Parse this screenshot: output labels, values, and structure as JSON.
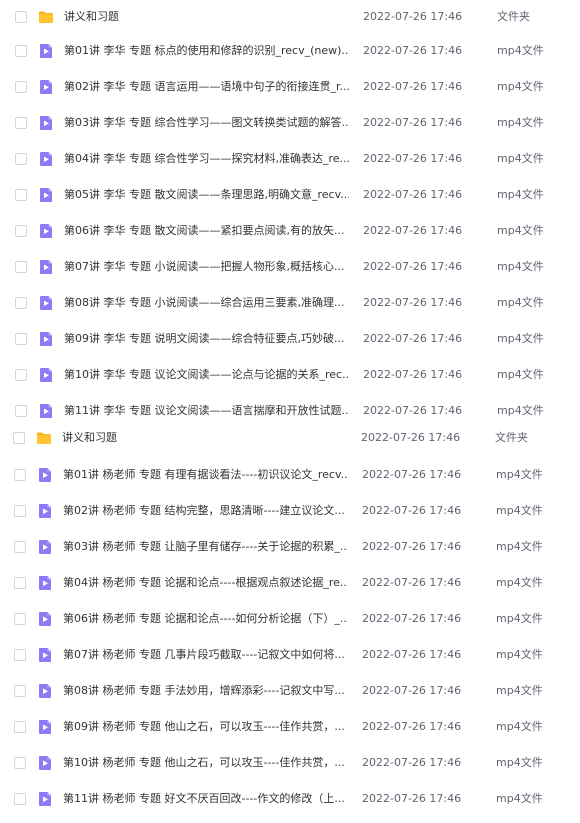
{
  "files": [
    {
      "name": "讲义和习题",
      "time": "2022-07-26 17:46",
      "type": "文件夹",
      "icon": "folder-icon"
    },
    {
      "name": "第01讲 李华 专题 标点的使用和修辞的识别_recv_(new)....",
      "time": "2022-07-26 17:46",
      "type": "mp4文件",
      "icon": "video-file-icon"
    },
    {
      "name": "第02讲 李华 专题 语言运用——语境中句子的衔接连贯_r...",
      "time": "2022-07-26 17:46",
      "type": "mp4文件",
      "icon": "video-file-icon"
    },
    {
      "name": "第03讲 李华 专题 综合性学习——图文转换类试题的解答...",
      "time": "2022-07-26 17:46",
      "type": "mp4文件",
      "icon": "video-file-icon"
    },
    {
      "name": "第04讲 李华 专题 综合性学习——探究材料,准确表达_re...",
      "time": "2022-07-26 17:46",
      "type": "mp4文件",
      "icon": "video-file-icon"
    },
    {
      "name": "第05讲 李华 专题 散文阅读——条理思路,明确文意_recv...",
      "time": "2022-07-26 17:46",
      "type": "mp4文件",
      "icon": "video-file-icon"
    },
    {
      "name": "第06讲 李华 专题 散文阅读——紧扣要点阅读,有的放矢...",
      "time": "2022-07-26 17:46",
      "type": "mp4文件",
      "icon": "video-file-icon"
    },
    {
      "name": "第07讲 李华 专题 小说阅读——把握人物形象,概括核心...",
      "time": "2022-07-26 17:46",
      "type": "mp4文件",
      "icon": "video-file-icon"
    },
    {
      "name": "第08讲 李华 专题 小说阅读——综合运用三要素,准确理...",
      "time": "2022-07-26 17:46",
      "type": "mp4文件",
      "icon": "video-file-icon"
    },
    {
      "name": "第09讲 李华 专题 说明文阅读——综合特征要点,巧妙破...",
      "time": "2022-07-26 17:46",
      "type": "mp4文件",
      "icon": "video-file-icon"
    },
    {
      "name": "第10讲 李华 专题 议论文阅读——论点与论据的关系_rec...",
      "time": "2022-07-26 17:46",
      "type": "mp4文件",
      "icon": "video-file-icon"
    },
    {
      "name": "第11讲 李华 专题 议论文阅读——语言揣摩和开放性试题...",
      "time": "2022-07-26 17:46",
      "type": "mp4文件",
      "icon": "video-file-icon"
    },
    {
      "name": "讲义和习题",
      "time": "2022-07-26 17:46",
      "type": "文件夹",
      "icon": "folder-icon"
    },
    {
      "name": "第01讲 杨老师 专题 有理有据谈看法----初识议论文_recv...",
      "time": "2022-07-26 17:46",
      "type": "mp4文件",
      "icon": "video-file-icon"
    },
    {
      "name": "第02讲 杨老师 专题 结构完整，思路清晰----建立议论文...",
      "time": "2022-07-26 17:46",
      "type": "mp4文件",
      "icon": "video-file-icon"
    },
    {
      "name": "第03讲 杨老师 专题 让脑子里有储存----关于论据的积累_...",
      "time": "2022-07-26 17:46",
      "type": "mp4文件",
      "icon": "video-file-icon"
    },
    {
      "name": "第04讲 杨老师 专题 论据和论点----根据观点叙述论据_re...",
      "time": "2022-07-26 17:46",
      "type": "mp4文件",
      "icon": "video-file-icon"
    },
    {
      "name": "第06讲 杨老师 专题 论据和论点----如何分析论据（下）_...",
      "time": "2022-07-26 17:46",
      "type": "mp4文件",
      "icon": "video-file-icon"
    },
    {
      "name": "第07讲 杨老师 专题 几事片段巧截取----记叙文中如何将...",
      "time": "2022-07-26 17:46",
      "type": "mp4文件",
      "icon": "video-file-icon"
    },
    {
      "name": "第08讲 杨老师 专题 手法妙用，增辉添彩----记叙文中写...",
      "time": "2022-07-26 17:46",
      "type": "mp4文件",
      "icon": "video-file-icon"
    },
    {
      "name": "第09讲 杨老师 专题 他山之石，可以攻玉----佳作共赏，...",
      "time": "2022-07-26 17:46",
      "type": "mp4文件",
      "icon": "video-file-icon"
    },
    {
      "name": "第10讲 杨老师 专题 他山之石，可以攻玉----佳作共赏，...",
      "time": "2022-07-26 17:46",
      "type": "mp4文件",
      "icon": "video-file-icon"
    },
    {
      "name": "第11讲 杨老师 专题 好文不厌百回改----作文的修改（上...",
      "time": "2022-07-26 17:46",
      "type": "mp4文件",
      "icon": "video-file-icon"
    }
  ],
  "colors": {
    "folder": "#ffc42e",
    "folder_tab": "#f5b21a",
    "video_file": "#8b7cf6",
    "video_play": "#ffffff",
    "text": "#333333",
    "meta_text": "#5f6470",
    "checkbox_border": "#d3d6dd"
  }
}
